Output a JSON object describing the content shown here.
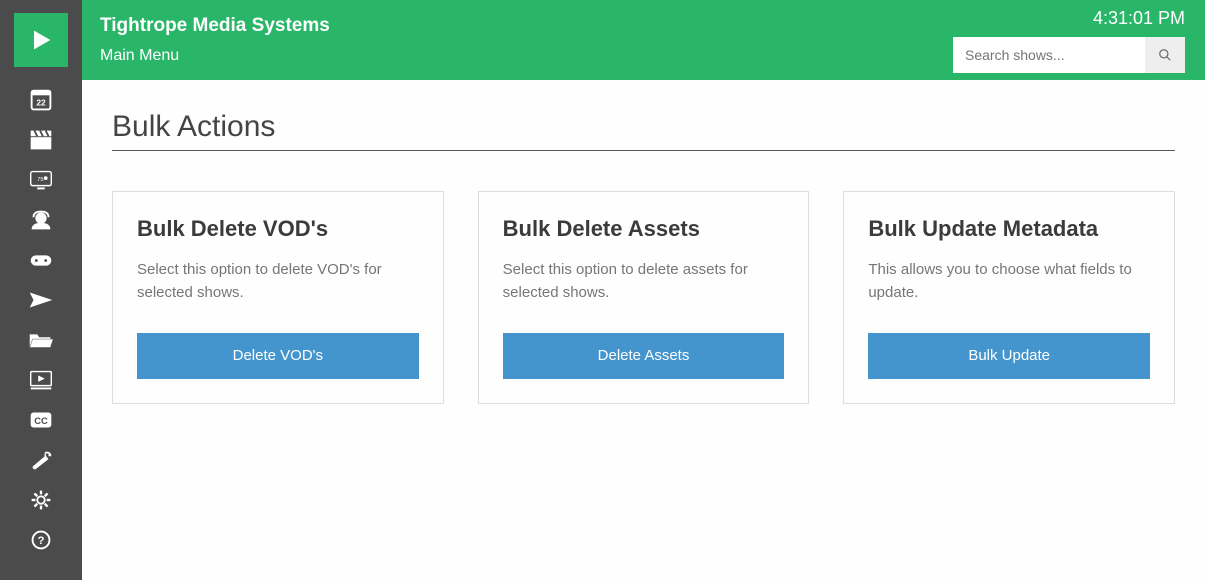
{
  "header": {
    "org_name": "Tightrope Media Systems",
    "menu_label": "Main Menu",
    "clock": "4:31:01 PM",
    "search_placeholder": "Search shows..."
  },
  "page": {
    "title": "Bulk Actions"
  },
  "cards": [
    {
      "title": "Bulk Delete VOD's",
      "desc": "Select this option to delete VOD's for selected shows.",
      "button": "Delete VOD's"
    },
    {
      "title": "Bulk Delete Assets",
      "desc": "Select this option to delete assets for selected shows.",
      "button": "Delete Assets"
    },
    {
      "title": "Bulk Update Metadata",
      "desc": "This allows you to choose what fields to update.",
      "button": "Bulk Update"
    }
  ],
  "sidebar_icons": [
    "calendar-icon",
    "clapper-icon",
    "tv-icon",
    "headset-icon",
    "gamepad-icon",
    "send-icon",
    "folder-open-icon",
    "monitor-play-icon",
    "cc-icon",
    "wrench-icon",
    "gear-icon",
    "help-icon"
  ]
}
